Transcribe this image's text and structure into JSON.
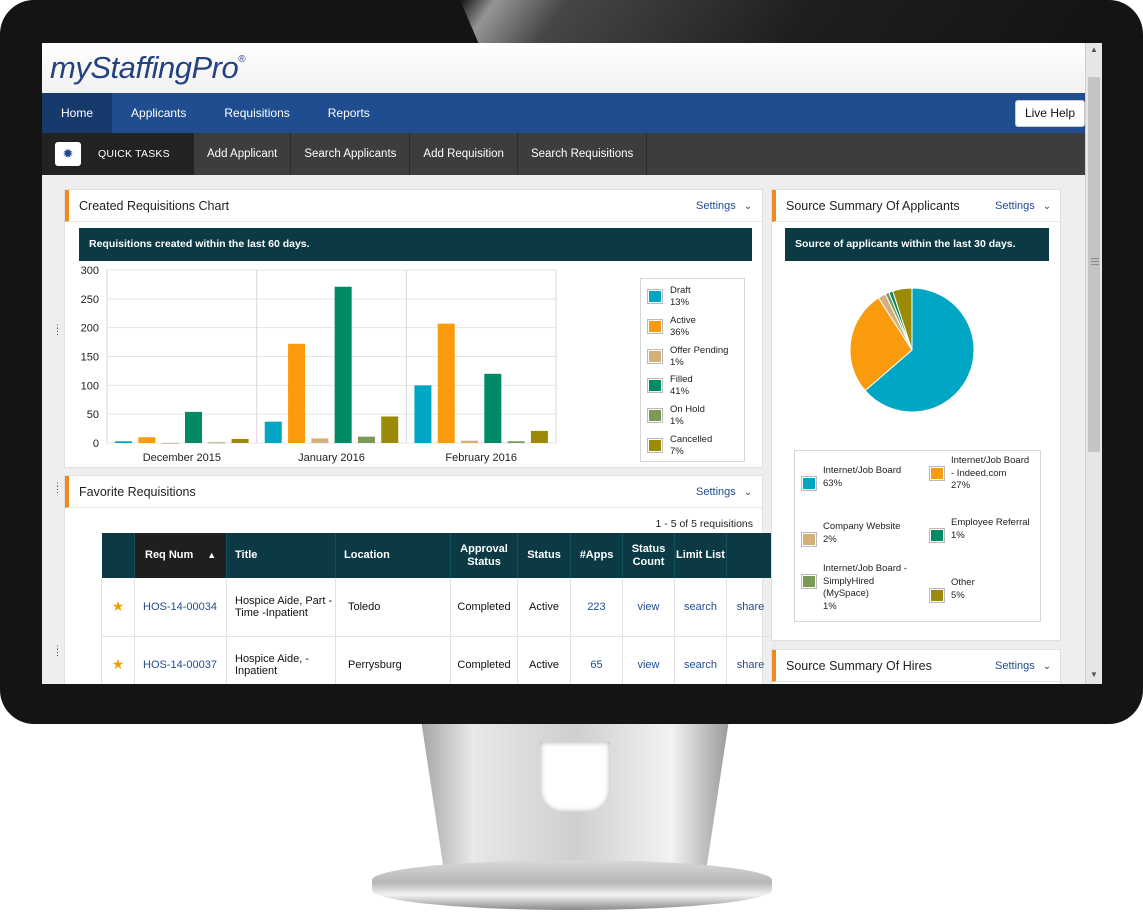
{
  "app": {
    "logo_text": "myStaffingPro",
    "logo_mark": "®"
  },
  "nav": {
    "items": [
      "Home",
      "Applicants",
      "Requisitions",
      "Reports"
    ],
    "active": "Home",
    "live_help": "Live Help"
  },
  "quick_tasks": {
    "label": "QUICK TASKS",
    "icon": "gear-icon",
    "items": [
      "Add Applicant",
      "Search Applicants",
      "Add Requisition",
      "Search Requisitions"
    ]
  },
  "requisitions_panel": {
    "title": "Created Requisitions Chart",
    "settings_label": "Settings",
    "banner": "Requisitions created within the last 60 days."
  },
  "favorites_panel": {
    "title": "Favorite Requisitions",
    "settings_label": "Settings",
    "count_label": "1 - 5 of 5 requisitions",
    "columns": [
      "Req Num",
      "Title",
      "Location",
      "Approval Status",
      "Status",
      "#Apps",
      "Status Count",
      "Limit List"
    ],
    "rows": [
      {
        "req_num": "HOS-14-00034",
        "title": "Hospice Aide, Part -Time -Inpatient",
        "location": "Toledo",
        "approval": "Completed",
        "status": "Active",
        "apps": "223",
        "status_count": "view",
        "limit": "search",
        "share": "share"
      },
      {
        "req_num": "HOS-14-00037",
        "title": "Hospice Aide, -Inpatient",
        "location": "Perrysburg",
        "approval": "Completed",
        "status": "Active",
        "apps": "65",
        "status_count": "view",
        "limit": "search",
        "share": "share"
      }
    ]
  },
  "source_applicants_panel": {
    "title": "Source Summary Of Applicants",
    "settings_label": "Settings",
    "banner": "Source of applicants within the last 30 days."
  },
  "source_hires_panel": {
    "title": "Source Summary Of Hires",
    "settings_label": "Settings"
  },
  "colors": {
    "nav_blue": "#1f4d90",
    "accent_orange": "#f08a1c",
    "banner_teal": "#0b3a45",
    "draft": "#00a7c4",
    "active": "#f99b0c",
    "offer_pending": "#d3b07a",
    "filled": "#008a66",
    "on_hold": "#7a9a55",
    "cancelled": "#9b8a05"
  },
  "chart_data": [
    {
      "type": "bar",
      "categories": [
        "December 2015",
        "January 2016",
        "February 2016"
      ],
      "ylim": [
        0,
        300
      ],
      "yticks": [
        0,
        50,
        100,
        150,
        200,
        250,
        300
      ],
      "legend_position": "right",
      "series": [
        {
          "name": "Draft",
          "share": "13%",
          "color": "#00a7c4",
          "values": [
            3,
            37,
            100
          ]
        },
        {
          "name": "Active",
          "share": "36%",
          "color": "#f99b0c",
          "values": [
            10,
            172,
            207
          ]
        },
        {
          "name": "Offer Pending",
          "share": "1%",
          "color": "#d3b07a",
          "values": [
            0,
            8,
            4
          ]
        },
        {
          "name": "Filled",
          "share": "41%",
          "color": "#008a66",
          "values": [
            54,
            271,
            120
          ]
        },
        {
          "name": "On Hold",
          "share": "1%",
          "color": "#7a9a55",
          "values": [
            1,
            11,
            3
          ]
        },
        {
          "name": "Cancelled",
          "share": "7%",
          "color": "#9b8a05",
          "values": [
            7,
            46,
            21
          ]
        }
      ]
    },
    {
      "type": "pie",
      "slices": [
        {
          "label": "Internet/Job Board",
          "share_label": "63%",
          "value": 63,
          "color": "#00a7c4"
        },
        {
          "label": "Internet/Job Board - Indeed.com",
          "share_label": "27%",
          "value": 27,
          "color": "#f99b0c"
        },
        {
          "label": "Company Website",
          "share_label": "2%",
          "value": 2,
          "color": "#d3b07a"
        },
        {
          "label": "Employee Referral",
          "share_label": "1%",
          "value": 1,
          "color": "#008a66"
        },
        {
          "label": "Internet/Job Board - SimplyHired (MySpace)",
          "share_label": "1%",
          "value": 1,
          "color": "#7a9a55"
        },
        {
          "label": "Other",
          "share_label": "5%",
          "value": 5,
          "color": "#9b8a05"
        }
      ]
    }
  ]
}
